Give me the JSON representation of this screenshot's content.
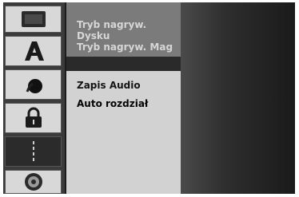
{
  "menu": {
    "disc_items": [
      {
        "label": "Tryb nagryw. Dysku"
      },
      {
        "label": "Tryb nagryw. Mag"
      }
    ],
    "record_items": [
      {
        "label": "Zapis Audio"
      },
      {
        "label": "Auto rozdział"
      }
    ]
  },
  "sidebar": {
    "items": [
      {
        "icon": "tv-icon"
      },
      {
        "icon": "language-a-icon"
      },
      {
        "icon": "audio-icon"
      },
      {
        "icon": "lock-icon"
      },
      {
        "icon": "record-settings-icon",
        "selected": true
      },
      {
        "icon": "disc-icon"
      }
    ]
  },
  "colors": {
    "sidebar_item": "#d8d8d8",
    "sidebar_selected": "#2b2b2b",
    "menu_top_bg": "#7b7b7b",
    "menu_bottom_bg": "#d2d2d2"
  }
}
